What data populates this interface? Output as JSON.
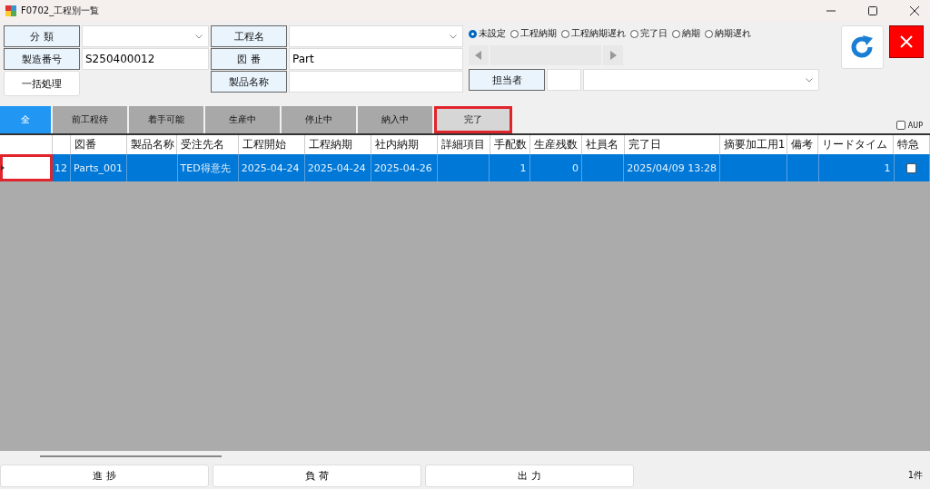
{
  "window": {
    "title": "F0702_工程別一覧"
  },
  "form": {
    "category": {
      "label": "分 類"
    },
    "serial": {
      "label": "製造番号",
      "value": "S250400012"
    },
    "batch_button": "一括処理",
    "process": {
      "label": "工程名"
    },
    "drawing": {
      "label": "図 番",
      "value": "Part"
    },
    "product": {
      "label": "製品名称"
    },
    "person": {
      "label": "担当者"
    }
  },
  "radios": [
    {
      "label": "未設定",
      "selected": true
    },
    {
      "label": "工程納期",
      "selected": false
    },
    {
      "label": "工程納期遅れ",
      "selected": false
    },
    {
      "label": "完了日",
      "selected": false
    },
    {
      "label": "納期",
      "selected": false
    },
    {
      "label": "納期遅れ",
      "selected": false
    }
  ],
  "tabs": [
    {
      "label": "全",
      "selected": true,
      "highlighted": false
    },
    {
      "label": "前工程待",
      "selected": false,
      "highlighted": false
    },
    {
      "label": "着手可能",
      "selected": false,
      "highlighted": false
    },
    {
      "label": "生産中",
      "selected": false,
      "highlighted": false
    },
    {
      "label": "停止中",
      "selected": false,
      "highlighted": false
    },
    {
      "label": "納入中",
      "selected": false,
      "highlighted": false
    },
    {
      "label": "完了",
      "selected": false,
      "highlighted": true
    }
  ],
  "aup": {
    "label": "AUP",
    "checked": false
  },
  "table": {
    "columns": [
      {
        "kind": "number"
      },
      {
        "label": "図番",
        "kind": "text"
      },
      {
        "label": "製品名称",
        "kind": "text"
      },
      {
        "label": "受注先名",
        "kind": "text"
      },
      {
        "label": "工程開始",
        "kind": "text"
      },
      {
        "label": "工程納期",
        "kind": "text"
      },
      {
        "label": "社内納期",
        "kind": "text"
      },
      {
        "label": "詳細項目",
        "kind": "text"
      },
      {
        "label": "手配数",
        "kind": "number"
      },
      {
        "label": "生産残数",
        "kind": "number"
      },
      {
        "label": "社員名",
        "kind": "text"
      },
      {
        "label": "完了日",
        "kind": "text"
      },
      {
        "label": "摘要加工用1",
        "kind": "text"
      },
      {
        "label": "備考",
        "kind": "text"
      },
      {
        "label": "リードタイム",
        "kind": "number"
      },
      {
        "label": "特急",
        "kind": "check"
      }
    ],
    "rows": [
      {
        "selected": true,
        "highlighted": true,
        "cells": [
          "12",
          "Parts_001",
          null,
          "TED得意先",
          "2025-04-24",
          "2025-04-24",
          "2025-04-26",
          null,
          "1",
          "0",
          null,
          "2025/04/09 13:28",
          null,
          null,
          "1",
          false
        ]
      }
    ]
  },
  "bottom_buttons": [
    "進 捗",
    "負 荷",
    "出 力"
  ],
  "status_bar": {
    "count": "1件"
  }
}
